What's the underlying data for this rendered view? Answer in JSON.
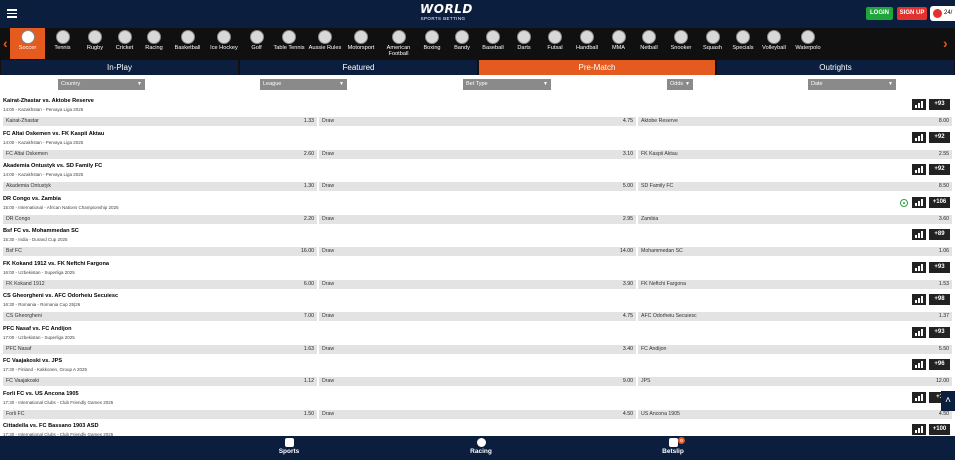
{
  "header": {
    "logo_line1": "WORLD",
    "logo_line2": "SPORTS BETTING",
    "login_label": "LOGIN",
    "signup_label": "SIGN UP",
    "support_label": "24/"
  },
  "sports": [
    {
      "label": "Soccer",
      "icon": "soccer-ball-icon",
      "active": true
    },
    {
      "label": "Tennis",
      "icon": "tennis-ball-icon"
    },
    {
      "label": "Rugby",
      "icon": "rugby-ball-icon"
    },
    {
      "label": "Cricket",
      "icon": "cricket-icon"
    },
    {
      "label": "Racing",
      "icon": "horse-racing-icon"
    },
    {
      "label": "Basketball",
      "icon": "basketball-icon"
    },
    {
      "label": "Ice Hockey",
      "icon": "ice-hockey-icon"
    },
    {
      "label": "Golf",
      "icon": "golf-icon"
    },
    {
      "label": "Table Tennis",
      "icon": "table-tennis-icon"
    },
    {
      "label": "Aussie Rules",
      "icon": "aussie-rules-icon"
    },
    {
      "label": "Motorsport",
      "icon": "motorsport-icon"
    },
    {
      "label": "American Football",
      "icon": "american-football-icon"
    },
    {
      "label": "Boxing",
      "icon": "boxing-glove-icon"
    },
    {
      "label": "Bandy",
      "icon": "bandy-icon"
    },
    {
      "label": "Baseball",
      "icon": "baseball-icon"
    },
    {
      "label": "Darts",
      "icon": "darts-icon"
    },
    {
      "label": "Futsal",
      "icon": "futsal-icon"
    },
    {
      "label": "Handball",
      "icon": "handball-icon"
    },
    {
      "label": "MMA",
      "icon": "mma-icon"
    },
    {
      "label": "Netball",
      "icon": "netball-icon"
    },
    {
      "label": "Snooker",
      "icon": "snooker-icon"
    },
    {
      "label": "Squash",
      "icon": "squash-icon"
    },
    {
      "label": "Specials",
      "icon": "specials-icon"
    },
    {
      "label": "Volleyball",
      "icon": "volleyball-icon"
    },
    {
      "label": "Waterpolo",
      "icon": "waterpolo-icon"
    }
  ],
  "tabs": [
    {
      "label": "In-Play"
    },
    {
      "label": "Featured"
    },
    {
      "label": "Pre-Match",
      "active": true
    },
    {
      "label": "Outrights"
    }
  ],
  "filters": {
    "country": "Country",
    "league": "League",
    "bet_type": "Bet Type",
    "odds": "Odds",
    "date": "Date"
  },
  "matches": [
    {
      "title": "Kairat-Zhastar vs. Aktobe Reserve",
      "info": "14:00 - Kazakhstan - Pervaya Liga 2025",
      "more": "+93",
      "home": "Kairat-Zhastar",
      "home_odd": "1.33",
      "draw": "Draw",
      "draw_odd": "4.75",
      "away": "Aktobe Reserve",
      "away_odd": "8.00"
    },
    {
      "title": "FC Altai Oskemen vs. FK Kaspii Aktau",
      "info": "14:00 - Kazakhstan - Pervaya Liga 2025",
      "more": "+92",
      "home": "FC Altai Oskemen",
      "home_odd": "2.60",
      "draw": "Draw",
      "draw_odd": "3.10",
      "away": "FK Kaspii Aktau",
      "away_odd": "2.55"
    },
    {
      "title": "Akademia Ontustyk vs. SD Family FC",
      "info": "14:00 - Kazakhstan - Pervaya Liga 2025",
      "more": "+92",
      "home": "Akademia Ontustyk",
      "home_odd": "1.30",
      "draw": "Draw",
      "draw_odd": "5.00",
      "away": "SD Family FC",
      "away_odd": "8.50"
    },
    {
      "title": "DR Congo vs. Zambia",
      "info": "15:00 - International - African Nations Championship 2025",
      "more": "+106",
      "live": true,
      "home": "DR Congo",
      "home_odd": "2.20",
      "draw": "Draw",
      "draw_odd": "2.95",
      "away": "Zambia",
      "away_odd": "3.60"
    },
    {
      "title": "Bsf FC vs. Mohammedan SC",
      "info": "15:30 - India - Durand Cup 2025",
      "more": "+89",
      "home": "Bsf FC",
      "home_odd": "16.00",
      "draw": "Draw",
      "draw_odd": "14.00",
      "away": "Mohammedan SC",
      "away_odd": "1.06"
    },
    {
      "title": "FK Kokand 1912 vs. FK Neftchi Fargona",
      "info": "16:00 - Uzbekistan - Superliga 2025",
      "more": "+93",
      "home": "FK Kokand 1912",
      "home_odd": "6.00",
      "draw": "Draw",
      "draw_odd": "3.90",
      "away": "FK Neftchi Fargona",
      "away_odd": "1.53"
    },
    {
      "title": "CS Gheorgheni vs. AFC Odorheiu Secuiesc",
      "info": "16:30 - Romania - Romania Cup 25|26",
      "more": "+98",
      "home": "CS Gheorgheni",
      "home_odd": "7.00",
      "draw": "Draw",
      "draw_odd": "4.75",
      "away": "AFC Odorheiu Secuiesc",
      "away_odd": "1.37"
    },
    {
      "title": "PFC Nasaf vs. FC Andijon",
      "info": "17:00 - Uzbekistan - Superliga 2025",
      "more": "+93",
      "home": "PFC Nasaf",
      "home_odd": "1.63",
      "draw": "Draw",
      "draw_odd": "3.40",
      "away": "FC Andijon",
      "away_odd": "5.50"
    },
    {
      "title": "FC Vaajakoski vs. JPS",
      "info": "17:30 - Finland - Kakkonen, Group A 2025",
      "more": "+96",
      "home": "FC Vaajakoski",
      "home_odd": "1.12",
      "draw": "Draw",
      "draw_odd": "9.00",
      "away": "JPS",
      "away_odd": "12.00"
    },
    {
      "title": "Forli FC vs. US Ancona 1905",
      "info": "17:30 - International Clubs - Club Friendly Games 2025",
      "more": "+1",
      "home": "Forli FC",
      "home_odd": "1.50",
      "draw": "Draw",
      "draw_odd": "4.50",
      "away": "US Ancona 1905",
      "away_odd": "4.50"
    },
    {
      "title": "Cittadella vs. FC Bassano 1903 ASD",
      "info": "17:30 - International Clubs - Club Friendly Games 2025",
      "more": "+100",
      "home": "",
      "home_odd": "",
      "draw": "",
      "draw_odd": "",
      "away": "",
      "away_odd": ""
    }
  ],
  "footer": {
    "sports_label": "Sports",
    "racing_label": "Racing",
    "betslip_label": "Betslip",
    "betslip_count": "0"
  },
  "colors": {
    "navy": "#0b1e3d",
    "accent": "#e45a1f",
    "login": "#1ea63c",
    "signup": "#e3312d"
  }
}
